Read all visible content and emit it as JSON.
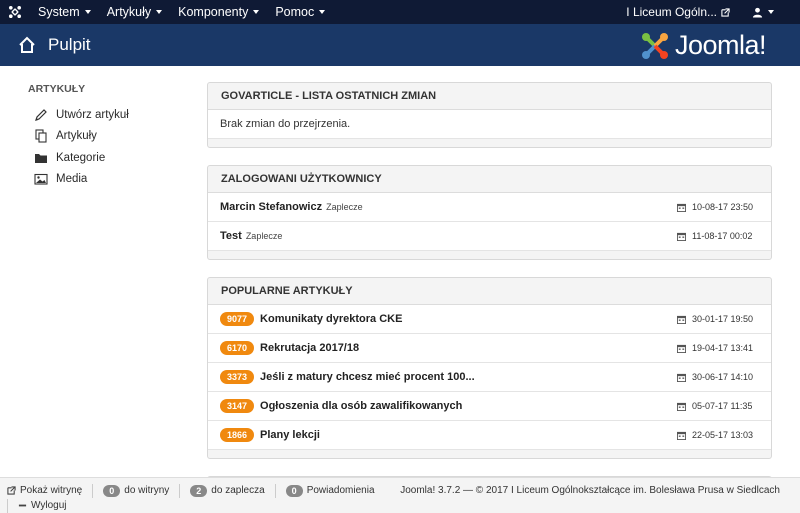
{
  "navbar": {
    "menus": [
      {
        "label": "System"
      },
      {
        "label": "Artykuły"
      },
      {
        "label": "Komponenty"
      },
      {
        "label": "Pomoc"
      }
    ],
    "site_link": "I Liceum Ogóln..."
  },
  "header": {
    "title": "Pulpit",
    "logo_text": "Joomla!"
  },
  "sidebar": {
    "heading": "ARTYKUŁY",
    "items": [
      {
        "label": "Utwórz artykuł",
        "icon": "pencil-icon"
      },
      {
        "label": "Artykuły",
        "icon": "copy-icon"
      },
      {
        "label": "Kategorie",
        "icon": "folder-icon"
      },
      {
        "label": "Media",
        "icon": "image-icon"
      }
    ]
  },
  "modules": {
    "govarticle": {
      "title": "GOVARTICLE - LISTA OSTATNICH ZMIAN",
      "empty": "Brak zmian do przejrzenia."
    },
    "logged": {
      "title": "ZALOGOWANI UŻYTKOWNICY",
      "rows": [
        {
          "name": "Marcin Stefanowicz",
          "sub": "Zaplecze",
          "date": "10-08-17 23:50"
        },
        {
          "name": "Test",
          "sub": "Zaplecze",
          "date": "11-08-17 00:02"
        }
      ]
    },
    "popular": {
      "title": "POPULARNE ARTYKUŁY",
      "rows": [
        {
          "hits": "9077",
          "title": "Komunikaty dyrektora CKE",
          "date": "30-01-17 19:50"
        },
        {
          "hits": "6170",
          "title": "Rekrutacja 2017/18",
          "date": "19-04-17 13:41"
        },
        {
          "hits": "3373",
          "title": "Jeśli z matury chcesz mieć procent 100...",
          "date": "30-06-17 14:10"
        },
        {
          "hits": "3147",
          "title": "Ogłoszenia dla osób zawalifikowanych",
          "date": "05-07-17 11:35"
        },
        {
          "hits": "1866",
          "title": "Plany lekcji",
          "date": "22-05-17 13:03"
        }
      ]
    }
  },
  "statusbar": {
    "show_site": "Pokaż witrynę",
    "site_count": "0",
    "site_label": "do witryny",
    "admin_count": "2",
    "admin_label": "do zaplecza",
    "notif_count": "0",
    "notif_label": "Powiadomienia",
    "logout": "Wyloguj",
    "version": "Joomla! 3.7.2 — © 2017 I Liceum Ogólnokształcące im. Bolesława Prusa w Siedlcach"
  },
  "colors": {
    "navbar": "#0f1a35",
    "header": "#1a3867",
    "badge": "#f0890f"
  }
}
